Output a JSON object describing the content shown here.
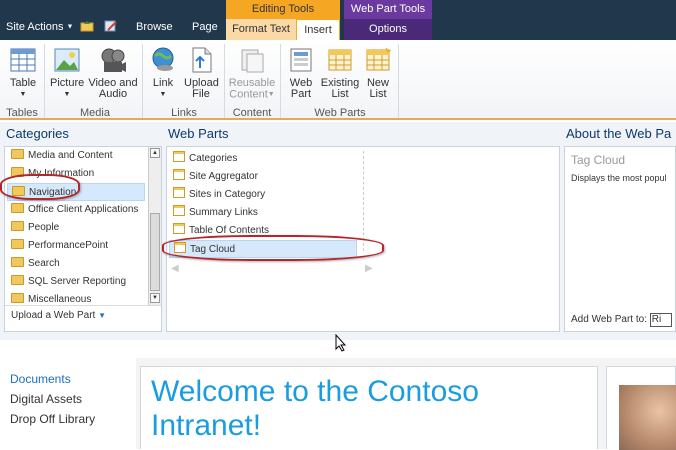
{
  "topbar": {
    "site_actions": "Site Actions",
    "browse_tab": "Browse",
    "page_tab": "Page",
    "editing_tools": "Editing Tools",
    "format_text_tab": "Format Text",
    "insert_tab": "Insert",
    "web_part_tools": "Web Part Tools",
    "options_tab": "Options"
  },
  "ribbon": {
    "tables_group": "Tables",
    "media_group": "Media",
    "links_group": "Links",
    "content_group": "Content",
    "webparts_group": "Web Parts",
    "table": "Table",
    "picture": "Picture",
    "video_audio_1": "Video and",
    "video_audio_2": "Audio",
    "link": "Link",
    "upload_file_1": "Upload",
    "upload_file_2": "File",
    "reusable_1": "Reusable",
    "reusable_2": "Content",
    "web_part_1": "Web",
    "web_part_2": "Part",
    "existing_list_1": "Existing",
    "existing_list_2": "List",
    "new_list_1": "New",
    "new_list_2": "List"
  },
  "categories": {
    "header": "Categories",
    "items": [
      "Media and Content",
      "My Information",
      "Navigation",
      "Office Client Applications",
      "People",
      "PerformancePoint",
      "Search",
      "SQL Server Reporting",
      "Miscellaneous"
    ],
    "upload_link": "Upload a Web Part"
  },
  "webparts": {
    "header": "Web Parts",
    "items": [
      "Categories",
      "Site Aggregator",
      "Sites in Category",
      "Summary Links",
      "Table Of Contents",
      "Tag Cloud"
    ]
  },
  "about": {
    "header": "About the Web Pa",
    "title": "Tag Cloud",
    "desc": "Displays the most popul",
    "add_label": "Add Web Part to:",
    "add_value": "Ri"
  },
  "quicklaunch": {
    "documents": "Documents",
    "digital_assets": "Digital Assets",
    "drop_off": "Drop Off Library"
  },
  "welcome": {
    "line1": "Welcome to the Contoso",
    "line2": "Intranet!"
  },
  "colors": {
    "accent": "#1a9de0",
    "highlight_ring": "#b3262a",
    "editing_tools_orange": "#f5a623",
    "web_part_tools_purple": "#5a2d8c"
  }
}
